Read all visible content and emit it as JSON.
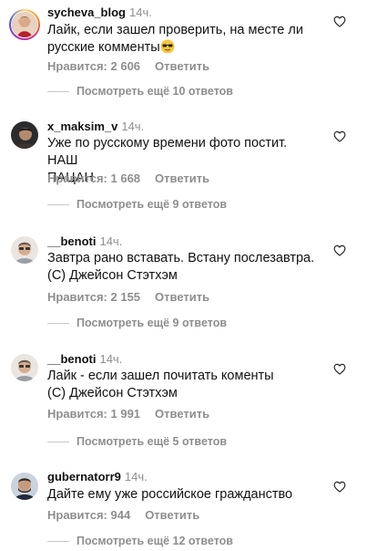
{
  "comments": [
    {
      "username": "sycheva_blog",
      "time": "14ч.",
      "text_line1": "Лайк, если зашел проверить, на месте ли",
      "text_line2": "русские комменты",
      "likes": "Нравится: 2 606",
      "reply_label": "Ответить",
      "view_replies": "Посмотреть ещё 10 ответов"
    },
    {
      "username": "x_maksim_v",
      "time": "14ч.",
      "text_line1": "Уже по русскому времени фото постит. НАШ",
      "text_line2": "ПАЦАН",
      "likes": "Нравится: 1 668",
      "reply_label": "Ответить",
      "view_replies": "Посмотреть ещё 9 ответов"
    },
    {
      "username": "__benoti",
      "time": "14ч.",
      "text_line1": "Завтра рано вставать. Встану послезавтра.",
      "text_line2": "(С) Джейсон Стэтхэм",
      "likes": "Нравится: 2 155",
      "reply_label": "Ответить",
      "view_replies": "Посмотреть ещё 9 ответов"
    },
    {
      "username": "__benoti",
      "time": "14ч.",
      "text_line1": "Лайк - если зашел почитать коменты",
      "text_line2": "(С) Джейсон Стэтхэм",
      "likes": "Нравится: 1 991",
      "reply_label": "Ответить",
      "view_replies": "Посмотреть ещё 5 ответов"
    },
    {
      "username": "gubernatorr9",
      "time": "14ч.",
      "text_line1": "Дайте ему уже российское гражданство",
      "likes": "Нравится: 944",
      "reply_label": "Ответить",
      "view_replies": "Посмотреть ещё 12 ответов"
    }
  ],
  "icons": {
    "like": "heart-outline-icon",
    "emoji": "sunglasses-emoji-icon"
  },
  "colors": {
    "secondary_text": "#8e8e8e",
    "divider_line": "#c7c7c7"
  }
}
